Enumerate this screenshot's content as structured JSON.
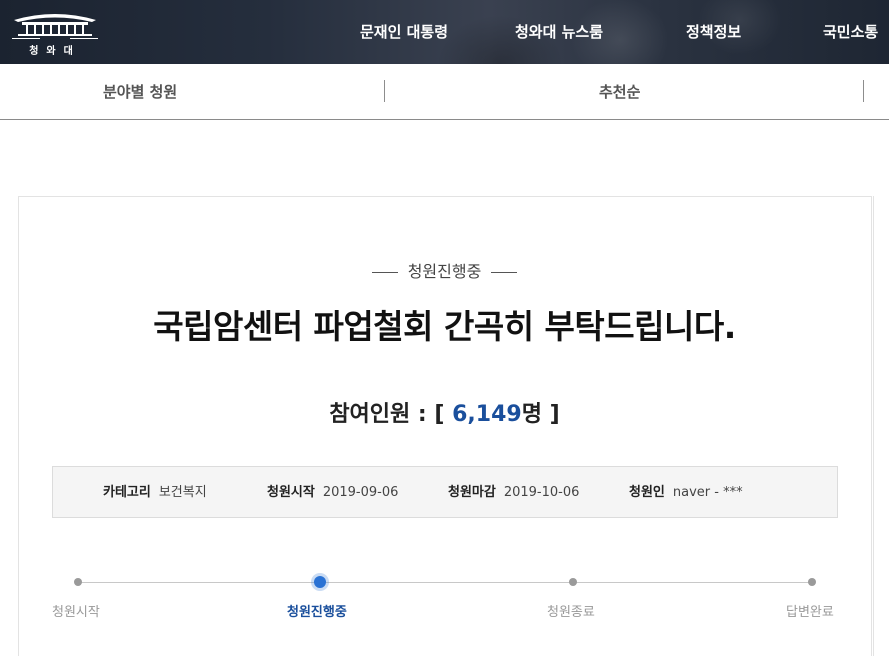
{
  "header": {
    "logo": {
      "name": "청와대",
      "icon": "blue-house-building-icon"
    },
    "nav": [
      "문재인 대통령",
      "청와대 뉴스룸",
      "정책정보",
      "국민소통"
    ]
  },
  "filters": {
    "category_label": "분야별 청원",
    "sort_label": "추천순"
  },
  "petition": {
    "status": "청원진행중",
    "title": "국립암센터 파업철회 간곡히 부탁드립니다.",
    "count_prefix": "참여인원 : [ ",
    "count_value": "6,149",
    "count_suffix": "명 ]",
    "info": {
      "category_key": "카테고리",
      "category_value": "보건복지",
      "start_key": "청원시작",
      "start_value": "2019-09-06",
      "end_key": "청원마감",
      "end_value": "2019-10-06",
      "author_key": "청원인",
      "author_value": "naver - ***"
    },
    "steps": [
      {
        "label": "청원시작",
        "active": false
      },
      {
        "label": "청원진행중",
        "active": true
      },
      {
        "label": "청원종료",
        "active": false
      },
      {
        "label": "답변완료",
        "active": false
      }
    ]
  },
  "colors": {
    "accent": "#1a4f9c",
    "active_dot": "#2a72d4",
    "header_bg": "#252e3d"
  }
}
